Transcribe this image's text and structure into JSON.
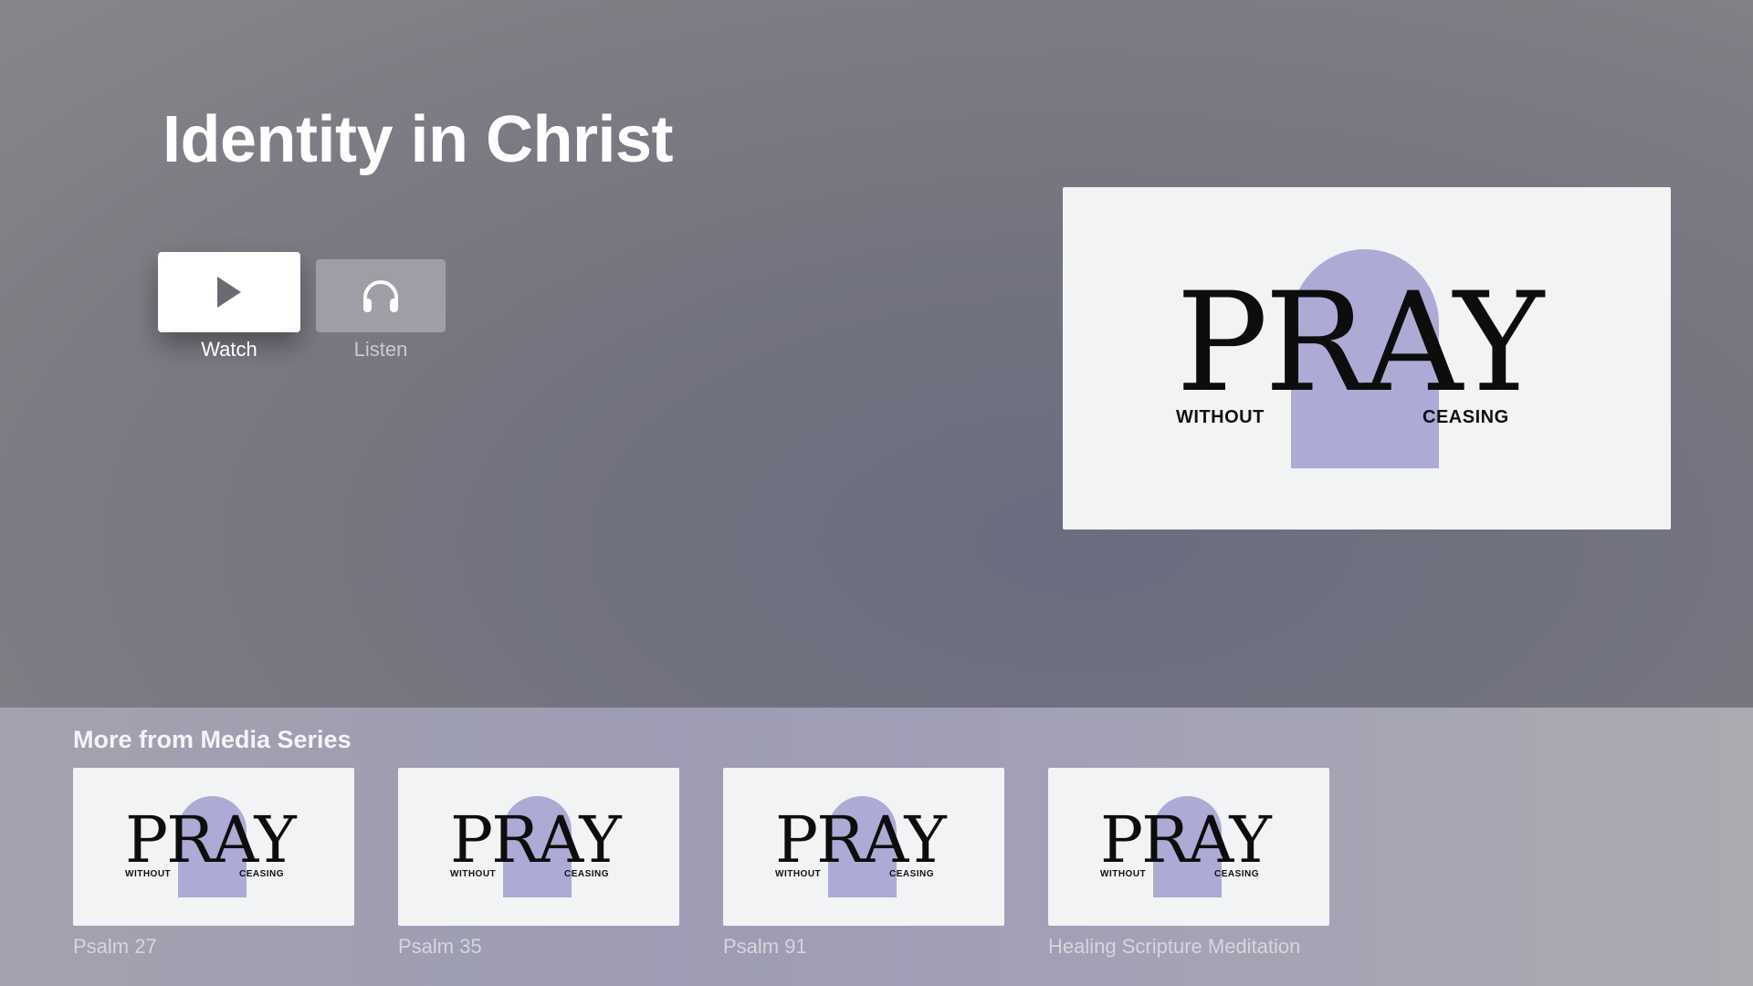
{
  "hero": {
    "title": "Identity in Christ",
    "watch_label": "Watch",
    "listen_label": "Listen",
    "artwork": {
      "word": "PRAY",
      "left_sub": "WITHOUT",
      "right_sub": "CEASING"
    }
  },
  "shelf": {
    "heading": "More from Media Series",
    "items": [
      {
        "title": "Psalm 27",
        "word": "PRAY",
        "left_sub": "WITHOUT",
        "right_sub": "CEASING"
      },
      {
        "title": "Psalm 35",
        "word": "PRAY",
        "left_sub": "WITHOUT",
        "right_sub": "CEASING"
      },
      {
        "title": "Psalm 91",
        "word": "PRAY",
        "left_sub": "WITHOUT",
        "right_sub": "CEASING"
      },
      {
        "title": "Healing Scripture Meditation",
        "word": "PRAY",
        "left_sub": "WITHOUT",
        "right_sub": "CEASING"
      }
    ]
  },
  "icons": {
    "watch": "play-icon",
    "listen": "headphones-icon"
  },
  "colors": {
    "artwork_background": "#f2f3f5",
    "artwork_accent": "#a9a6d3",
    "focused_button": "#ffffff",
    "unfocused_button": "#9e9ea6"
  }
}
